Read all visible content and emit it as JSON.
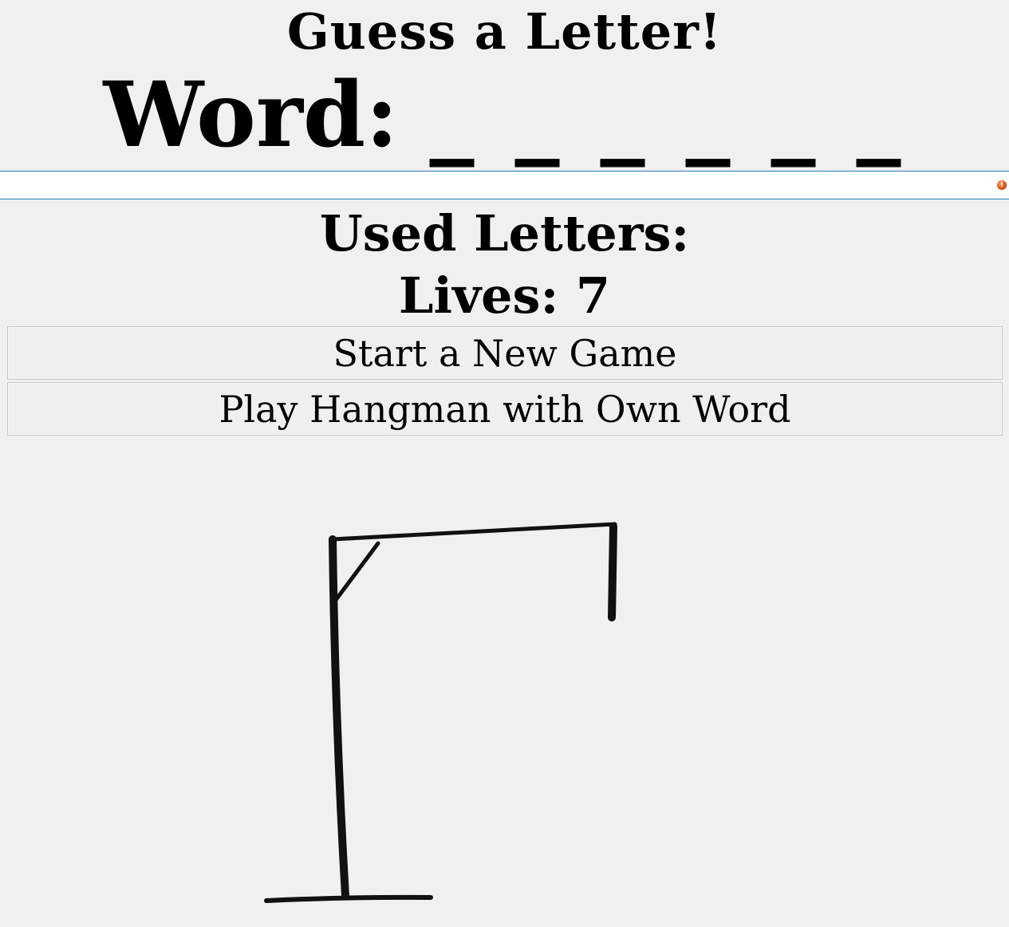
{
  "header": {
    "title": "Guess a Letter!",
    "word_label": "Word:",
    "word_blanks": "_ _ _ _ _ _"
  },
  "guess_input": {
    "value": "",
    "placeholder": ""
  },
  "status": {
    "used_letters_label": "Used Letters:",
    "lives_label": "Lives: 7"
  },
  "buttons": {
    "new_game": "Start a New Game",
    "own_word": "Play Hangman with Own Word"
  },
  "game": {
    "lives": 7,
    "word_length": 6,
    "used_letters": []
  },
  "icons": {
    "input_warning": "warning-icon",
    "drawing": "gallows-drawing"
  },
  "colors": {
    "background": "#f0f0f0",
    "input_border": "#2a7fb0",
    "warning": "#d8400e",
    "ink": "#111111"
  }
}
